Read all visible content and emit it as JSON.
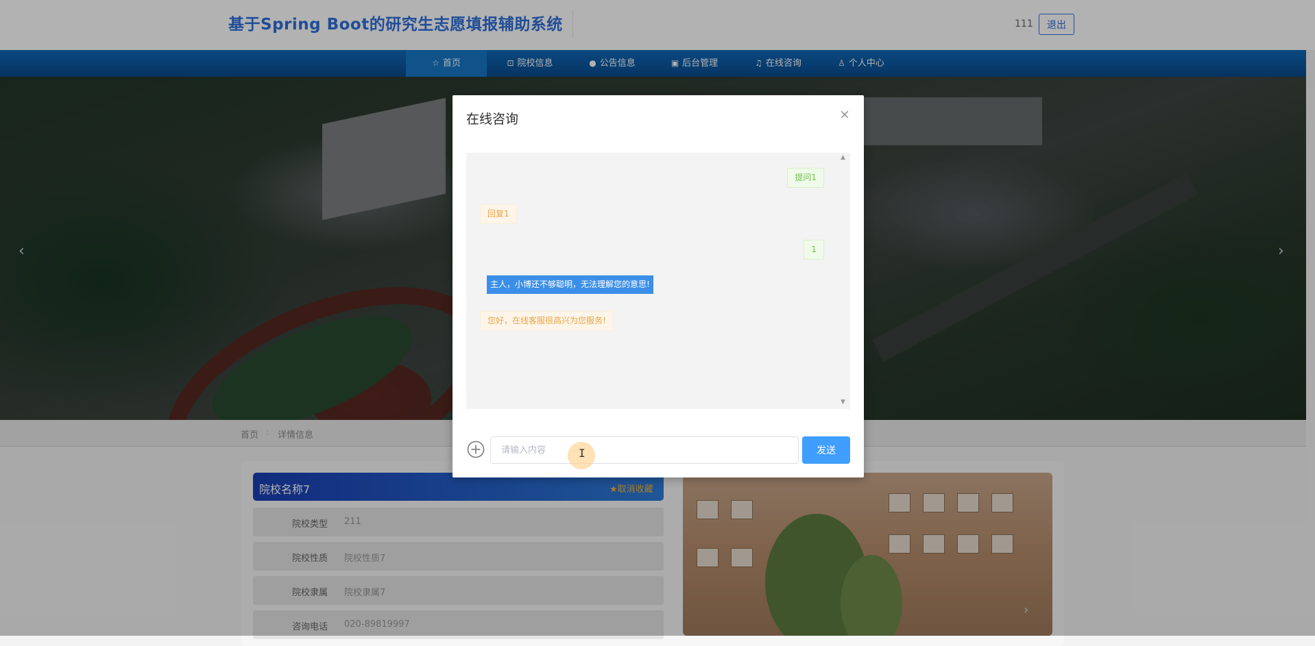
{
  "header": {
    "site_title": "基于Spring Boot的研究生志愿填报辅助系统",
    "username": "111",
    "logout_label": "退出"
  },
  "nav": {
    "items": [
      {
        "label": "首页",
        "icon": "star-icon",
        "active": true
      },
      {
        "label": "院校信息",
        "icon": "briefcase-icon"
      },
      {
        "label": "公告信息",
        "icon": "info-icon"
      },
      {
        "label": "后台管理",
        "icon": "clipboard-icon"
      },
      {
        "label": "在线咨询",
        "icon": "headset-icon"
      },
      {
        "label": "个人中心",
        "icon": "user-icon"
      }
    ]
  },
  "banner": {
    "prev_arrow": "‹",
    "next_arrow": "›"
  },
  "breadcrumb": {
    "home": "首页",
    "separator": ":",
    "current": "详情信息"
  },
  "detail": {
    "school_name": "院校名称7",
    "favorite_label": "★取消收藏",
    "rows": [
      {
        "label": "院校类型",
        "value": "211"
      },
      {
        "label": "院校性质",
        "value": "院校性质7"
      },
      {
        "label": "院校隶属",
        "value": "院校隶属7"
      },
      {
        "label": "咨询电话",
        "value": "020-89819997"
      }
    ]
  },
  "dialog": {
    "title": "在线咨询",
    "close_symbol": "×",
    "messages": [
      {
        "role": "user",
        "text": "提问1"
      },
      {
        "role": "bot",
        "text": "回复1"
      },
      {
        "role": "user",
        "text": "1"
      },
      {
        "role": "bot",
        "text": "主人，小博还不够聪明，无法理解您的意思!",
        "highlighted": true
      },
      {
        "role": "bot",
        "text": "您好，在线客服很高兴为您服务!"
      }
    ],
    "input_placeholder": "请输入内容",
    "input_value": "",
    "send_label": "发送"
  },
  "colors": {
    "primary": "#409eff",
    "brand_title": "#2e6fd8",
    "nav_bg": "#0f69b9",
    "user_bubble": "#6cc24a",
    "bot_bubble": "#e8a64a",
    "favorite": "#f2b533"
  }
}
